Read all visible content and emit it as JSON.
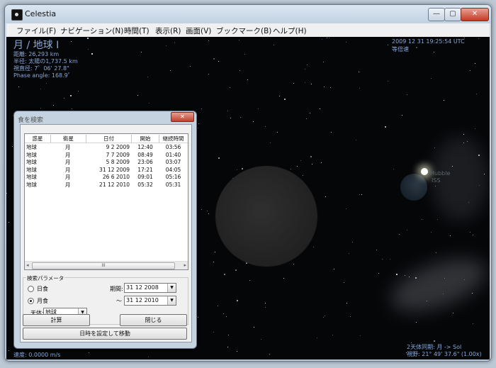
{
  "window": {
    "title": "Celestia",
    "min_icon": "minimize-icon",
    "max_icon": "maximize-icon",
    "close_icon": "close-icon",
    "min_glyph": "—",
    "max_glyph": "▢",
    "close_glyph": "✕"
  },
  "menu": [
    "ファイル(F)",
    "ナビゲーション(N)",
    "時間(T)",
    "表示(R)",
    "画面(V)",
    "ブックマーク(B)",
    "ヘルプ(H)"
  ],
  "overlay": {
    "object_title": "月 / 地球 I",
    "distance": "距離: 26,293 km",
    "radius": "半径: 太陽の1,737.5 km",
    "apparent_diameter": "視直径: 7゜06' 27.8\"",
    "phase_angle": "Phase angle: 168.9゜",
    "datetime": "2009 12 31 19:25:54 UTC",
    "time_rate": "等倍速",
    "speed": "速度: 0.0000 m/s",
    "sync_mode": "2天体同期: 月 -> Sol",
    "fov": "視野: 21° 49' 37.6\" (1.00x)",
    "label_hubble": "Hubble",
    "label_iss": "ISS"
  },
  "dialog": {
    "title": "食を検索",
    "close_glyph": "✕",
    "columns": [
      "惑星",
      "衛星",
      "日付",
      "開始",
      "継続時間"
    ],
    "rows": [
      [
        "地球",
        "月",
        "9 2 2009",
        "12:40",
        "03:56"
      ],
      [
        "地球",
        "月",
        "7 7 2009",
        "08:49",
        "01:40"
      ],
      [
        "地球",
        "月",
        "5 8 2009",
        "23:06",
        "03:07"
      ],
      [
        "地球",
        "月",
        "31 12 2009",
        "17:21",
        "04:05"
      ],
      [
        "地球",
        "月",
        "26 6 2010",
        "09:01",
        "05:16"
      ],
      [
        "地球",
        "月",
        "21 12 2010",
        "05:32",
        "05:31"
      ]
    ],
    "scroll_left": "◂",
    "scroll_right": "▸",
    "scroll_thumb": "III",
    "params_label": "検索パラメータ",
    "solar_label": "日食",
    "lunar_label": "月食",
    "period_label": "期間:",
    "start_date": "31 12 2008",
    "tilde": "～",
    "end_date": "31 12 2010",
    "body_label": "天体:",
    "body_value": "地球",
    "dropdown_glyph": "▼",
    "compute_button": "計算",
    "close_button": "閉じる",
    "goto_button": "日時を設定して移動"
  }
}
